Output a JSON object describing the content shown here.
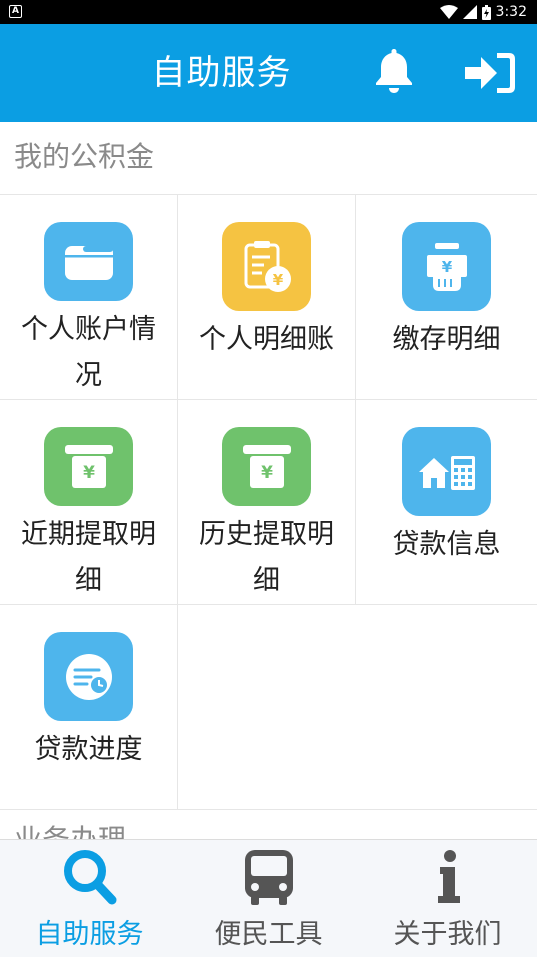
{
  "status_bar": {
    "time": "3:32"
  },
  "header": {
    "title": "自助服务",
    "bell_icon": "bell-icon",
    "logout_icon": "sign-in-icon"
  },
  "sections": [
    {
      "title": "我的公积金",
      "items": [
        {
          "label": "个人账户情况",
          "icon": "wallet-icon",
          "color": "#4eb5ec"
        },
        {
          "label": "个人明细账",
          "icon": "yen-document-icon",
          "color": "#f5c342"
        },
        {
          "label": "缴存明细",
          "icon": "hand-money-icon",
          "color": "#4eb5ec"
        },
        {
          "label": "近期提取明细",
          "icon": "atm-yen-icon",
          "color": "#6fc26c"
        },
        {
          "label": "历史提取明细",
          "icon": "atm-yen-icon",
          "color": "#6fc26c"
        },
        {
          "label": "贷款信息",
          "icon": "house-calculator-icon",
          "color": "#4eb5ec"
        },
        {
          "label": "贷款进度",
          "icon": "progress-clock-icon",
          "color": "#4eb5ec"
        }
      ]
    },
    {
      "title": "业务办理"
    }
  ],
  "bottom_nav": [
    {
      "label": "自助服务",
      "icon": "search-icon",
      "active": true
    },
    {
      "label": "便民工具",
      "icon": "bus-icon",
      "active": false
    },
    {
      "label": "关于我们",
      "icon": "info-icon",
      "active": false
    }
  ],
  "colors": {
    "primary": "#0b9ee3",
    "nav_inactive": "#555555"
  }
}
